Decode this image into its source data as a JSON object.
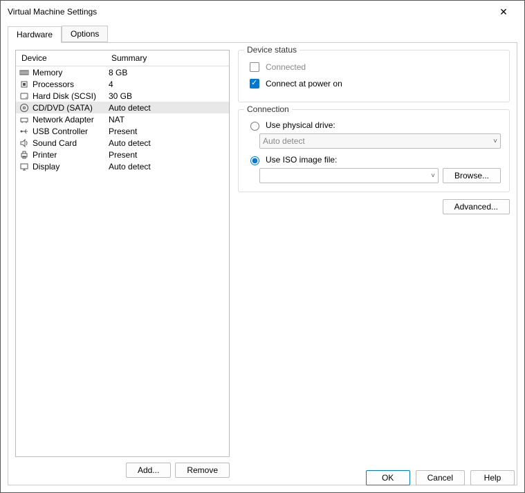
{
  "window_title": "Virtual Machine Settings",
  "tabs": {
    "hardware": "Hardware",
    "options": "Options"
  },
  "columns": {
    "device": "Device",
    "summary": "Summary"
  },
  "devices": [
    {
      "name": "Memory",
      "summary": "8 GB",
      "icon": "memory"
    },
    {
      "name": "Processors",
      "summary": "4",
      "icon": "cpu"
    },
    {
      "name": "Hard Disk (SCSI)",
      "summary": "30 GB",
      "icon": "hdd"
    },
    {
      "name": "CD/DVD (SATA)",
      "summary": "Auto detect",
      "icon": "cd",
      "selected": true
    },
    {
      "name": "Network Adapter",
      "summary": "NAT",
      "icon": "net"
    },
    {
      "name": "USB Controller",
      "summary": "Present",
      "icon": "usb"
    },
    {
      "name": "Sound Card",
      "summary": "Auto detect",
      "icon": "sound"
    },
    {
      "name": "Printer",
      "summary": "Present",
      "icon": "printer"
    },
    {
      "name": "Display",
      "summary": "Auto detect",
      "icon": "display"
    }
  ],
  "buttons": {
    "add": "Add...",
    "remove": "Remove",
    "browse": "Browse...",
    "advanced": "Advanced...",
    "ok": "OK",
    "cancel": "Cancel",
    "help": "Help"
  },
  "status_group": {
    "title": "Device status",
    "connected": "Connected",
    "connect_poweron": "Connect at power on"
  },
  "connection_group": {
    "title": "Connection",
    "physical": "Use physical drive:",
    "autodetect": "Auto detect",
    "iso": "Use ISO image file:",
    "iso_path": ""
  }
}
